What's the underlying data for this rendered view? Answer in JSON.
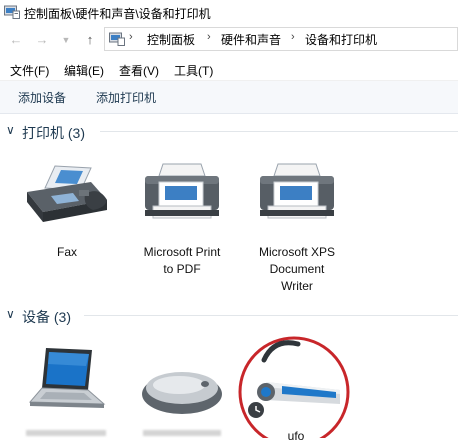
{
  "window": {
    "title": "控制面板\\硬件和声音\\设备和打印机"
  },
  "nav": {
    "back": "back-arrow",
    "forward": "forward-arrow",
    "recent": "dropdown",
    "up": "up-arrow"
  },
  "address": {
    "crumbs": [
      "控制面板",
      "硬件和声音",
      "设备和打印机"
    ],
    "separator": "›"
  },
  "menu": {
    "file": "文件(F)",
    "edit": "编辑(E)",
    "view": "查看(V)",
    "tools": "工具(T)"
  },
  "commands": {
    "add_device": "添加设备",
    "add_printer": "添加打印机"
  },
  "printers": {
    "header": "打印机 (3)",
    "items": [
      {
        "lines": [
          "Fax"
        ]
      },
      {
        "lines": [
          "Microsoft Print",
          "to PDF"
        ]
      },
      {
        "lines": [
          "Microsoft XPS",
          "Document",
          "Writer"
        ]
      }
    ]
  },
  "devices": {
    "header": "设备 (3)",
    "items": [
      {
        "name": ""
      },
      {
        "name": ""
      },
      {
        "name": "ufo"
      }
    ]
  },
  "colors": {
    "accent_text": "#1e3950",
    "highlight_circle": "#c8262a",
    "command_bar_bg": "#f6f8fb"
  }
}
